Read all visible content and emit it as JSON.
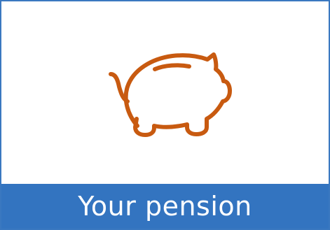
{
  "tile": {
    "label": "Your pension",
    "icon": "piggy-bank-icon",
    "colors": {
      "border": "#3a78c0",
      "label_background": "#3374c0",
      "label_text": "#ffffff",
      "icon_stroke": "#c85a10"
    }
  }
}
